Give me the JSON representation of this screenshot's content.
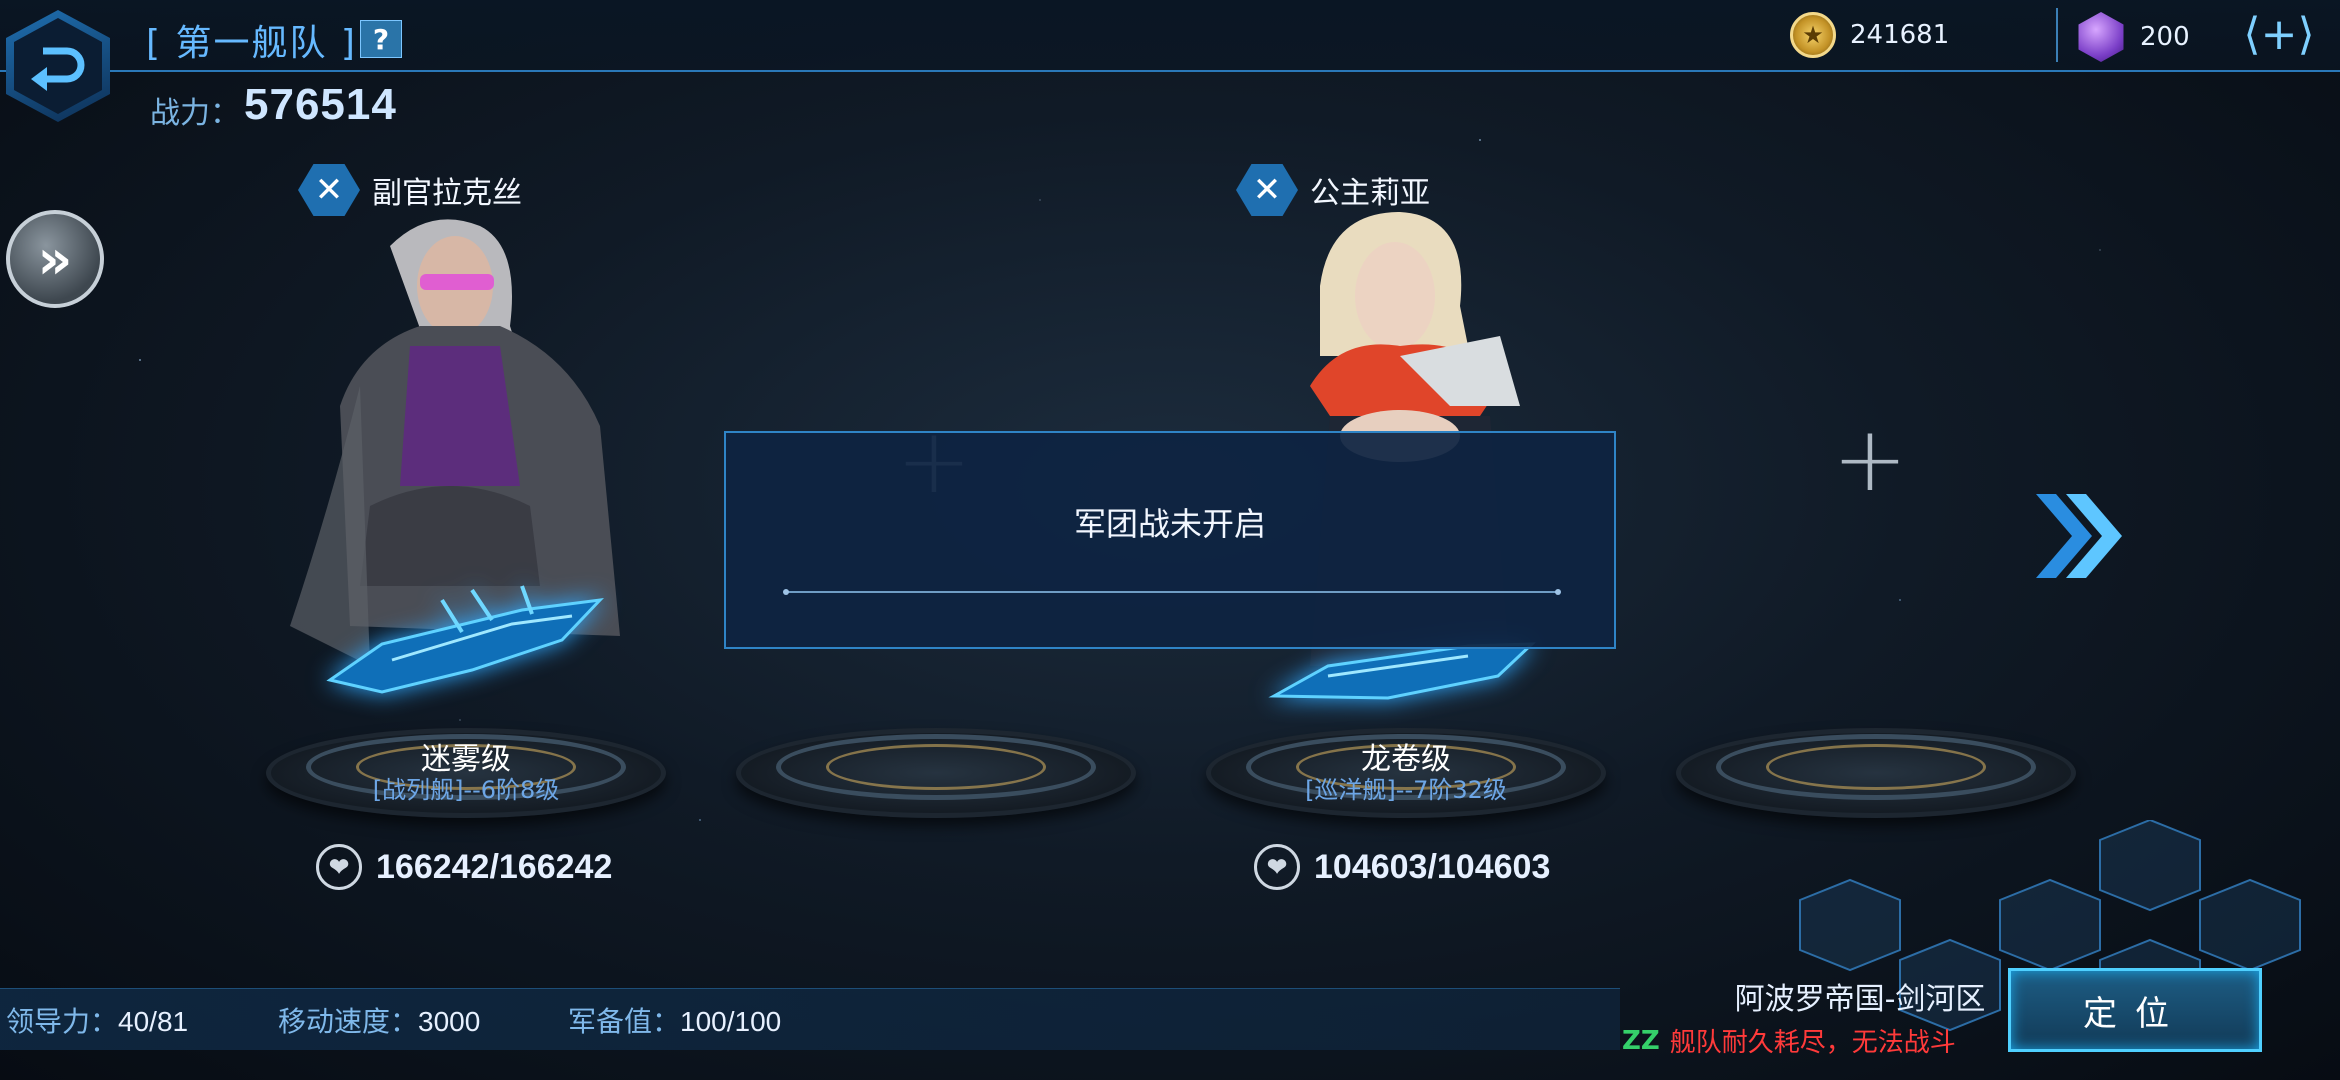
{
  "header": {
    "fleet_title": "[ 第一舰队 ]",
    "help_label": "?",
    "power_label": "战力：",
    "power_value": "576514",
    "gold_amount": "241681",
    "gem_amount": "200",
    "add_label": "⟨+⟩"
  },
  "officers": [
    {
      "name": "副官拉克丝",
      "ship_class": "迷雾级",
      "ship_grade": "[战列舰]--6阶8级",
      "hp": "166242/166242"
    },
    {
      "name": "公主莉亚",
      "ship_class": "龙卷级",
      "ship_grade": "[巡洋舰]--7阶32级",
      "hp": "104603/104603"
    }
  ],
  "modal": {
    "message": "军团战未开启"
  },
  "footer": {
    "leadership_label": "领导力：",
    "leadership_value": "40/81",
    "speed_label": "移动速度：",
    "speed_value": "3000",
    "supply_label": "军备值：",
    "supply_value": "100/100",
    "region": "阿波罗帝国-剑河区",
    "warning_icon": "ZZ",
    "warning": "舰队耐久耗尽，无法战斗",
    "locate_label": "定位"
  },
  "icons": {
    "back": "back-arrow-icon",
    "expand": "double-chevron-right-icon",
    "coin": "star-coin-icon",
    "gem": "purple-gem-icon",
    "remove": "close-icon",
    "heart": "heart-icon",
    "add_slot": "plus-icon",
    "next": "chevron-right-icon"
  },
  "colors": {
    "accent": "#2f84c6",
    "warning": "#ff3a3a",
    "text_blue": "#66b9ff"
  }
}
